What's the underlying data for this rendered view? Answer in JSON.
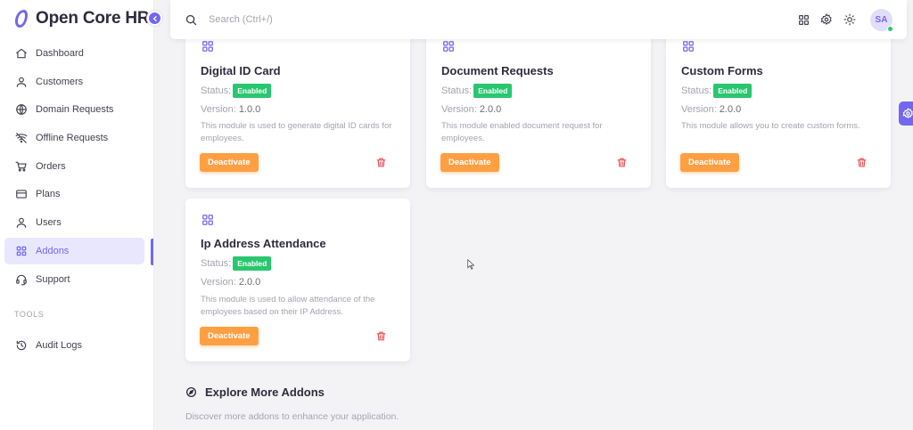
{
  "brand": {
    "name": "Open Core HR",
    "logo_color": "#7367f0"
  },
  "search": {
    "placeholder": "Search (Ctrl+/)"
  },
  "user": {
    "initials": "SA"
  },
  "sidebar": {
    "items": [
      {
        "label": "Dashboard",
        "icon": "home-icon"
      },
      {
        "label": "Customers",
        "icon": "user-icon"
      },
      {
        "label": "Domain Requests",
        "icon": "globe-icon"
      },
      {
        "label": "Offline Requests",
        "icon": "wifi-off-icon"
      },
      {
        "label": "Orders",
        "icon": "cart-icon"
      },
      {
        "label": "Plans",
        "icon": "credit-card-icon"
      },
      {
        "label": "Users",
        "icon": "user-icon"
      },
      {
        "label": "Addons",
        "icon": "grid-icon",
        "active": true
      },
      {
        "label": "Support",
        "icon": "headset-icon"
      }
    ],
    "tools_title": "TOOLS",
    "tools": [
      {
        "label": "Audit Logs",
        "icon": "history-icon"
      }
    ]
  },
  "addons": [
    {
      "title": "Digital ID Card",
      "status_label": "Status:",
      "status": "Enabled",
      "version_label": "Version:",
      "version": "1.0.0",
      "description": "This module is used to generate digital ID cards for employees.",
      "action": "Deactivate"
    },
    {
      "title": "Document Requests",
      "status_label": "Status:",
      "status": "Enabled",
      "version_label": "Version:",
      "version": "2.0.0",
      "description": "This module enabled document request for employees.",
      "action": "Deactivate"
    },
    {
      "title": "Custom Forms",
      "status_label": "Status:",
      "status": "Enabled",
      "version_label": "Version:",
      "version": "2.0.0",
      "description": "This module allows you to create custom forms.",
      "action": "Deactivate"
    },
    {
      "title": "Ip Address Attendance",
      "status_label": "Status:",
      "status": "Enabled",
      "version_label": "Version:",
      "version": "2.0.0",
      "description": "This module is used to allow attendance of the employees based on their IP Address.",
      "action": "Deactivate"
    }
  ],
  "explore": {
    "title": "Explore More Addons",
    "subtitle": "Discover more addons to enhance your application."
  },
  "colors": {
    "primary": "#7367f0",
    "success": "#28c76f",
    "warning": "#ff9f43",
    "danger": "#ea5455"
  }
}
